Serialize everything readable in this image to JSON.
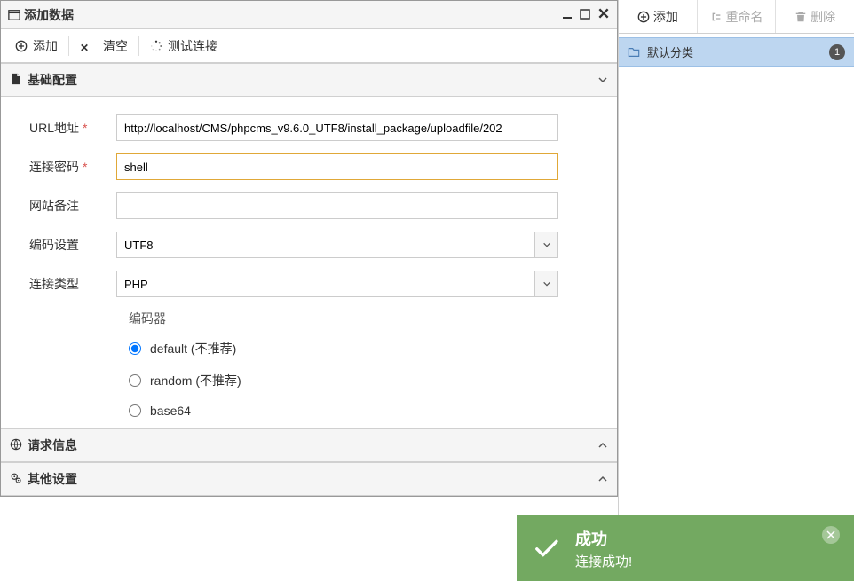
{
  "dialog": {
    "title": "添加数据",
    "toolbar": {
      "add": "添加",
      "clear": "清空",
      "test_connection": "测试连接"
    },
    "panels": {
      "basic_config": "基础配置",
      "request_info": "请求信息",
      "other_settings": "其他设置"
    },
    "form": {
      "url_label": "URL地址",
      "url_value": "http://localhost/CMS/phpcms_v9.6.0_UTF8/install_package/uploadfile/202",
      "password_label": "连接密码",
      "password_value": "shell",
      "remark_label": "网站备注",
      "remark_value": "",
      "encode_label": "编码设置",
      "encode_value": "UTF8",
      "conn_type_label": "连接类型",
      "conn_type_value": "PHP",
      "encoder_section_label": "编码器",
      "encoders": [
        {
          "label": "default (不推荐)",
          "checked": true
        },
        {
          "label": "random (不推荐)",
          "checked": false
        },
        {
          "label": "base64",
          "checked": false
        }
      ]
    }
  },
  "sidebar": {
    "toolbar": {
      "add": "添加",
      "rename": "重命名",
      "delete": "删除"
    },
    "tree": [
      {
        "label": "默认分类",
        "count": "1"
      }
    ]
  },
  "toast": {
    "title": "成功",
    "message": "连接成功!"
  }
}
